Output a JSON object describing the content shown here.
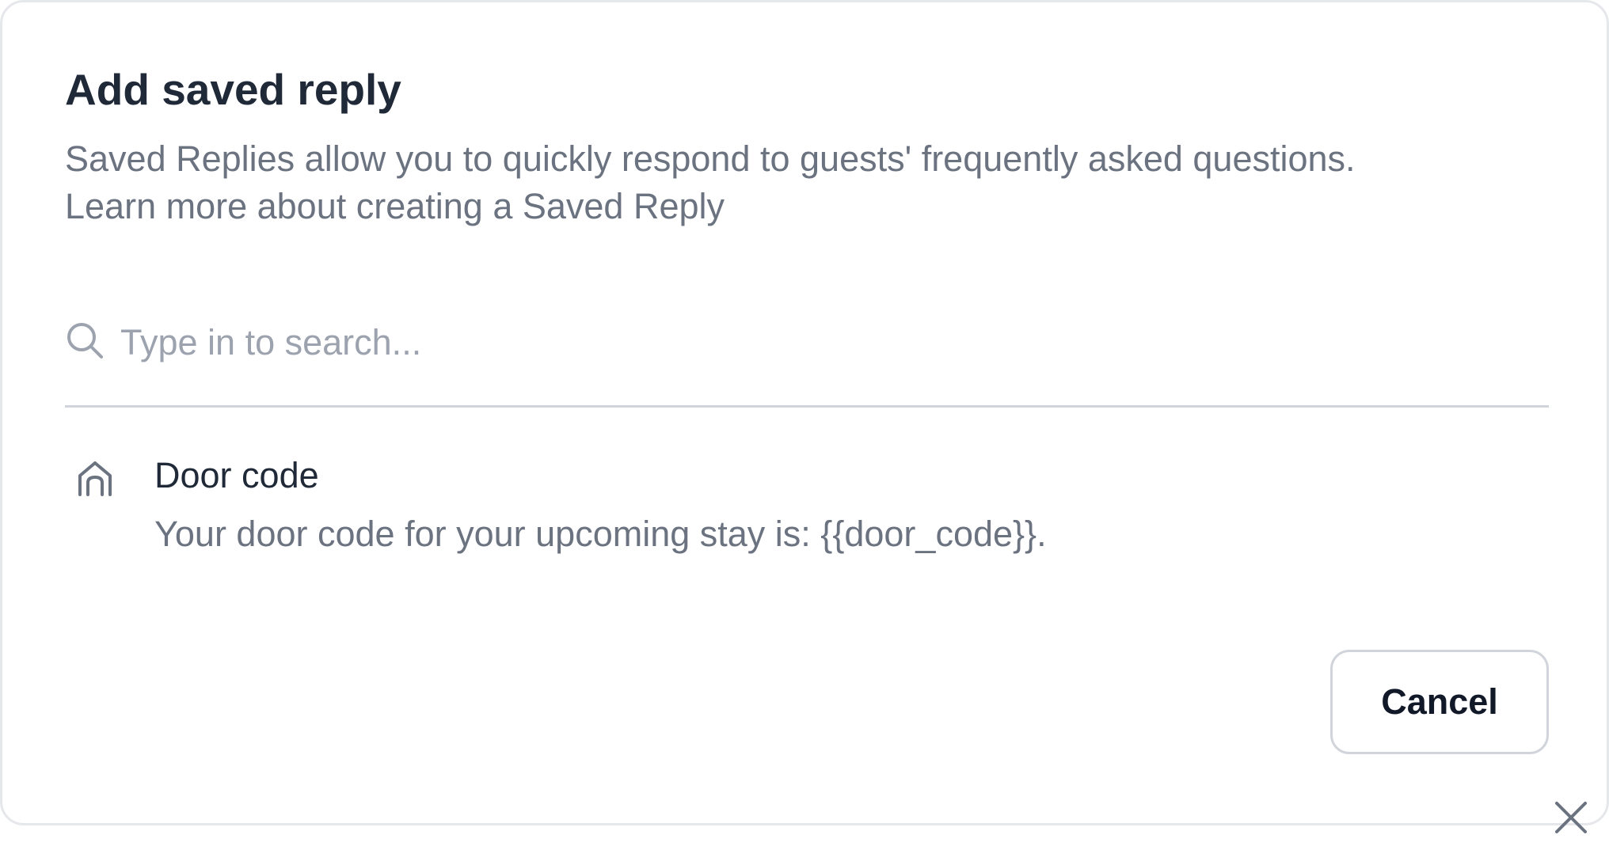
{
  "dialog": {
    "title": "Add saved reply",
    "subtitle": "Saved Replies allow you to quickly respond to guests' frequently asked questions.",
    "learn_more_link": "Learn more about creating a Saved Reply"
  },
  "search": {
    "icon": "search-icon",
    "placeholder": "Type in to search...",
    "value": ""
  },
  "replies": [
    {
      "icon": "home-icon",
      "title": "Door code",
      "body": "Your door code for your upcoming stay is: {{door_code}}."
    }
  ],
  "actions": {
    "cancel_label": "Cancel"
  },
  "close": {
    "icon": "close-icon"
  },
  "colors": {
    "title_text": "#1f2937",
    "muted_text": "#6b7280",
    "placeholder_text": "#9ca3af",
    "border": "#d1d5db"
  }
}
